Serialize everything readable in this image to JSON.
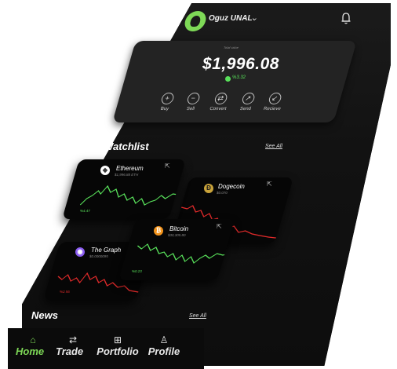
{
  "header": {
    "username": "Oguz UNAL",
    "chevron": "⌄",
    "bell_icon": "bell-icon"
  },
  "balance_card": {
    "caption": "Total value",
    "amount": "$1,996.08",
    "change": "%3.32",
    "actions": [
      {
        "label": "Buy",
        "icon": "plus-icon",
        "glyph": "+"
      },
      {
        "label": "Sell",
        "icon": "minus-icon",
        "glyph": "−"
      },
      {
        "label": "Convert",
        "icon": "convert-icon",
        "glyph": "⇄"
      },
      {
        "label": "Send",
        "icon": "send-icon",
        "glyph": "↗"
      },
      {
        "label": "Recieve",
        "icon": "receive-icon",
        "glyph": "↙"
      }
    ]
  },
  "watchlist": {
    "title": "Watchlist",
    "see_all": "See All",
    "coins": [
      {
        "name": "Ethereum",
        "price": "$1,996.88 ETH",
        "change": "%4.47",
        "trend": "up",
        "symbol": "◆"
      },
      {
        "name": "Dogecoin",
        "price": "$0.070",
        "change": "",
        "trend": "down",
        "symbol": "Ð"
      },
      {
        "name": "Bitcoin",
        "price": "$30,305.80",
        "change": "%0.23",
        "trend": "up",
        "symbol": "₿"
      },
      {
        "name": "The Graph",
        "price": "$0.0000095",
        "change": "%2.56",
        "trend": "down",
        "symbol": "◉"
      }
    ]
  },
  "news": {
    "title": "News",
    "see_all": "See All"
  },
  "tabbar": {
    "tabs": [
      {
        "label": "Home",
        "icon": "home-icon",
        "glyph": "⌂",
        "active": true
      },
      {
        "label": "Trade",
        "icon": "trade-icon",
        "glyph": "⇄",
        "active": false
      },
      {
        "label": "Portfolio",
        "icon": "portfolio-icon",
        "glyph": "⊞",
        "active": false
      },
      {
        "label": "Profile",
        "icon": "profile-icon",
        "glyph": "♙",
        "active": false
      }
    ]
  },
  "colors": {
    "accent": "#7ed957",
    "up": "#58e05a",
    "down": "#e02a2a",
    "card": "#232323"
  }
}
